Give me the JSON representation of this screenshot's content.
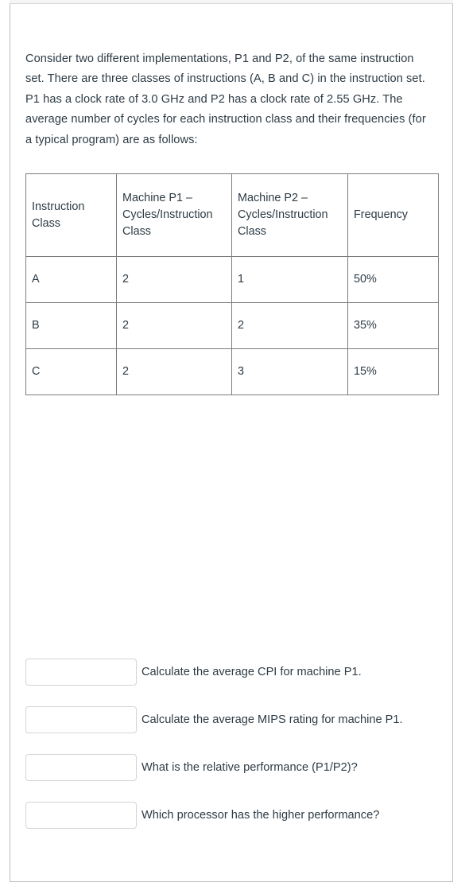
{
  "prompt": {
    "text": "Consider two different implementations, P1 and P2, of the same instruction set.  There are three classes of instructions (A, B and C) in the instruction set.  P1 has a clock rate of 3.0 GHz and P2 has a clock rate of 2.55 GHz.  The average number of cycles for each instruction class and their frequencies (for a typical program) are as follows:"
  },
  "table": {
    "headers": [
      "Instruction Class",
      "Machine P1 – Cycles/Instruction Class",
      "Machine P2 – Cycles/Instruction Class",
      "Frequency"
    ],
    "rows": [
      {
        "class": "A",
        "p1_cycles": "2",
        "p2_cycles": "1",
        "frequency": "50%"
      },
      {
        "class": "B",
        "p1_cycles": "2",
        "p2_cycles": "2",
        "frequency": "35%"
      },
      {
        "class": "C",
        "p1_cycles": "2",
        "p2_cycles": "3",
        "frequency": "15%"
      }
    ]
  },
  "answers": [
    {
      "value": "",
      "placeholder": "",
      "label": "Calculate the average CPI for machine P1."
    },
    {
      "value": "",
      "placeholder": "",
      "label": "Calculate the average MIPS rating for machine P1."
    },
    {
      "value": "",
      "placeholder": "",
      "label": "What is the relative performance (P1/P2)?"
    },
    {
      "value": "",
      "placeholder": "",
      "label": "Which processor has the higher performance?"
    }
  ],
  "colors": {
    "text": "#2d3b45",
    "table_border": "#7c7c7c",
    "card_border": "#bfbfbf",
    "input_border": "#d4d4d4",
    "strip": "#f5f5f5"
  }
}
